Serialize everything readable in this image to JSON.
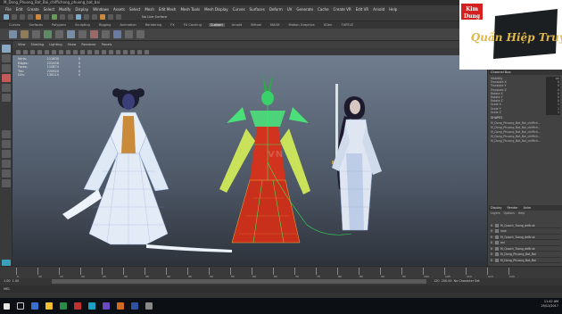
{
  "window": {
    "title": "M_Dong_Phuong_Bat_Bai_chiffichong_phuong_bat_bai"
  },
  "menubar": [
    "File",
    "Edit",
    "Create",
    "Select",
    "Modify",
    "Display",
    "Windows",
    "Assets",
    "Select",
    "Mesh",
    "Edit Mesh",
    "Mesh Tools",
    "Mesh Display",
    "Curves",
    "Surfaces",
    "Deform",
    "UV",
    "Generate",
    "Cache",
    "Create VR",
    "Edit VR",
    "Arnold",
    "Help"
  ],
  "statusline": {
    "no_live_surface": "No Live Surface"
  },
  "shelf_tabs": [
    "Curves",
    "Surfaces",
    "Polygons",
    "Sculpting",
    "Rigging",
    "Animation",
    "Rendering",
    "FX",
    "FX Caching",
    "Custom",
    "Arnold",
    "Bifrost",
    "MASH",
    "Motion Graphics",
    "XGen",
    "TURTLE"
  ],
  "shelf_active": "Custom",
  "viewport_menu": [
    "View",
    "Shading",
    "Lighting",
    "Show",
    "Renderer",
    "Panels"
  ],
  "hud": [
    {
      "label": "Verts:",
      "v1": "111630",
      "v2": "0"
    },
    {
      "label": "Edges:",
      "v1": "222458",
      "v2": "0"
    },
    {
      "label": "Faces:",
      "v1": "110874",
      "v2": "0"
    },
    {
      "label": "Tris:",
      "v1": "220920",
      "v2": "0"
    },
    {
      "label": "UVs:",
      "v1": "136115",
      "v2": "0"
    }
  ],
  "watermark": "VN",
  "logo": {
    "line1": "Kim",
    "line2": "Dung",
    "line3": "Quần Hiệp Truyện"
  },
  "channel_box": {
    "header": "Channel Box",
    "attributes": [
      {
        "name": "Visibility",
        "value": "on"
      },
      {
        "name": "Translate X",
        "value": "0"
      },
      {
        "name": "Translate Y",
        "value": "0"
      },
      {
        "name": "Translate Z",
        "value": "0"
      },
      {
        "name": "Rotate X",
        "value": "0"
      },
      {
        "name": "Rotate Y",
        "value": "0"
      },
      {
        "name": "Rotate Z",
        "value": "0"
      },
      {
        "name": "Scale X",
        "value": "1"
      },
      {
        "name": "Scale Y",
        "value": "1"
      },
      {
        "name": "Scale Z",
        "value": "1"
      }
    ],
    "shapes_header": "SHAPES",
    "shapes": [
      "M_Dong_Phuong_Bat_Bai_chiffich...",
      "M_Dong_Phuong_Bat_Bai_chiffich...",
      "M_Dong_Phuong_Bat_Bai_chiffich...",
      "M_Dong_Phuong_Bat_Bai_chiffich...",
      "M_Dong_Phuong_Bat_Bai_chiffich..."
    ]
  },
  "layers": {
    "tabs": [
      "Display",
      "Render",
      "Anim"
    ],
    "menu": [
      "Layers",
      "Options",
      "Help"
    ],
    "rows": [
      "M_Quach_Tuong_deBruk",
      "new",
      "M_Quach_Tuong_deBruk",
      "ani",
      "M_Quach_Tuong_deBruk",
      "M_Dong_Phuong_Bat_Bai",
      "M_Dong_Phuong_Bat_Bai"
    ]
  },
  "timeline": {
    "ticks": [
      "5",
      "10",
      "15",
      "20",
      "25",
      "30",
      "35",
      "40",
      "45",
      "50",
      "55",
      "60",
      "65",
      "70",
      "75",
      "80",
      "85",
      "90",
      "95",
      "100",
      "105",
      "110",
      "115",
      "120"
    ],
    "range_start": "1.00",
    "range_start2": "1.00",
    "range_end": "120",
    "range_end2": "200.00",
    "no_char": "No Character Set"
  },
  "cmdline": {
    "label": "MEL"
  },
  "clock": {
    "time": "11:42 AM",
    "date": "29/12/2017"
  }
}
